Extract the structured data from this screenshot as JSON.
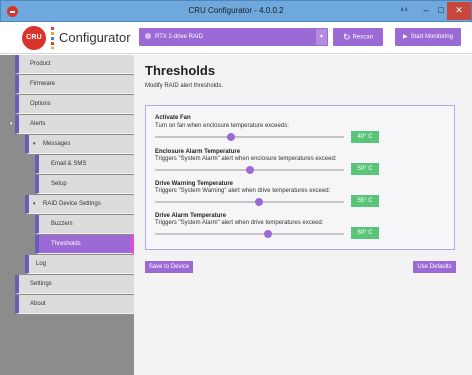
{
  "window": {
    "title": "CRU Configurator - 4.0.0.2",
    "restore_glyph": "⁴⁴",
    "minimize_glyph": "–",
    "maximize_glyph": "□",
    "close_glyph": "✕"
  },
  "header": {
    "logo_text": "CRU",
    "app_name": "Configurator",
    "device_selected": "RTX 2-drive RAID",
    "dropdown_glyph": "▾",
    "rescan_label": "Rescan",
    "rescan_glyph": "↻",
    "monitor_label": "Start Monitoring",
    "monitor_glyph": "▶"
  },
  "sidebar": {
    "items": [
      {
        "label": "Product",
        "caret": ""
      },
      {
        "label": "Firmware",
        "caret": ""
      },
      {
        "label": "Options",
        "caret": ""
      },
      {
        "label": "Alerts",
        "caret": "▾"
      },
      {
        "label": "Messages",
        "caret": "▾"
      },
      {
        "label": "Email & SMS",
        "caret": ""
      },
      {
        "label": "Setup",
        "caret": ""
      },
      {
        "label": "RAID Device Settings",
        "caret": "▾"
      },
      {
        "label": "Buzzers",
        "caret": ""
      },
      {
        "label": "Thresholds",
        "caret": ""
      },
      {
        "label": "Log",
        "caret": ""
      },
      {
        "label": "Settings",
        "caret": ""
      },
      {
        "label": "About",
        "caret": ""
      }
    ]
  },
  "main": {
    "title": "Thresholds",
    "subtitle": "Modify RAID alert thresholds.",
    "settings": [
      {
        "title": "Activate Fan",
        "description": "Turn on fan when enclosure temperature exceeds:",
        "value": "40° C",
        "level": 0.4
      },
      {
        "title": "Enclosure Alarm Temperature",
        "description": "Triggers \"System Alarm\" alert when enclosure temperatures exceed:",
        "value": "50° C",
        "level": 0.5
      },
      {
        "title": "Drive Warning Temperature",
        "description": "Triggers \"System Warning\" alert when drive temperatures exceed:",
        "value": "55° C",
        "level": 0.55
      },
      {
        "title": "Drive Alarm Temperature",
        "description": "Triggers \"System Alarm\" alert when drive temperatures exceed:",
        "value": "60° C",
        "level": 0.6
      }
    ],
    "save_label": "Save to Device",
    "defaults_label": "Use Defaults"
  },
  "colors": {
    "accent": "#9b6ad6",
    "active_marker": "#e34bd8",
    "badge": "#5ac47b",
    "title_bar": "#6fa8dc",
    "close": "#c9463d"
  }
}
